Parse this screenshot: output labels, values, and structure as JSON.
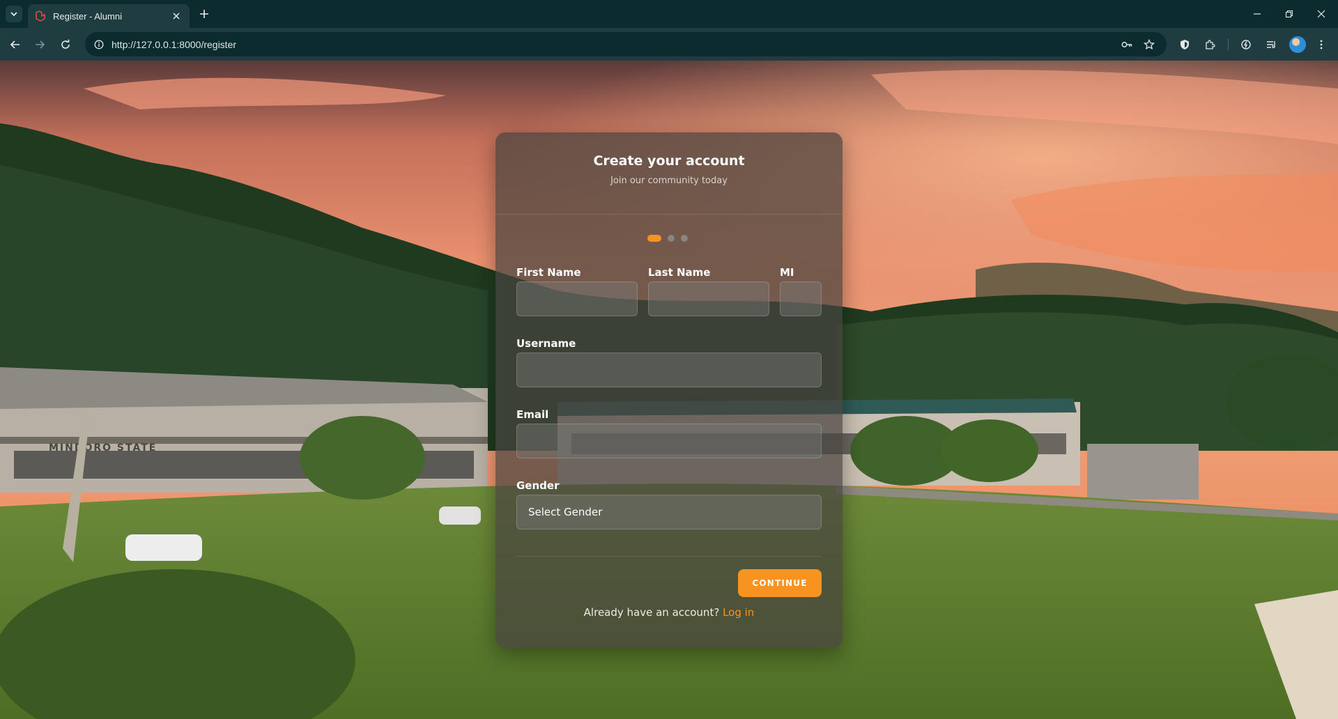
{
  "browser": {
    "tab_title": "Register - Alumni",
    "url": "http://127.0.0.1:8000/register"
  },
  "card": {
    "title": "Create your account",
    "subtitle": "Join our community today",
    "steps_total": 3,
    "step_current": 1,
    "fields": {
      "first_name_label": "First Name",
      "last_name_label": "Last Name",
      "mi_label": "MI",
      "username_label": "Username",
      "email_label": "Email",
      "gender_label": "Gender",
      "gender_value": "Select Gender"
    },
    "continue_label": "CONTINUE",
    "login_prompt": "Already have an account?",
    "login_link": "Log in"
  },
  "background": {
    "building_sign": "MINDORO STATE"
  },
  "colors": {
    "accent": "#f7931e",
    "browser_frame": "#0b2b2e",
    "toolbar": "#1f3d40"
  }
}
